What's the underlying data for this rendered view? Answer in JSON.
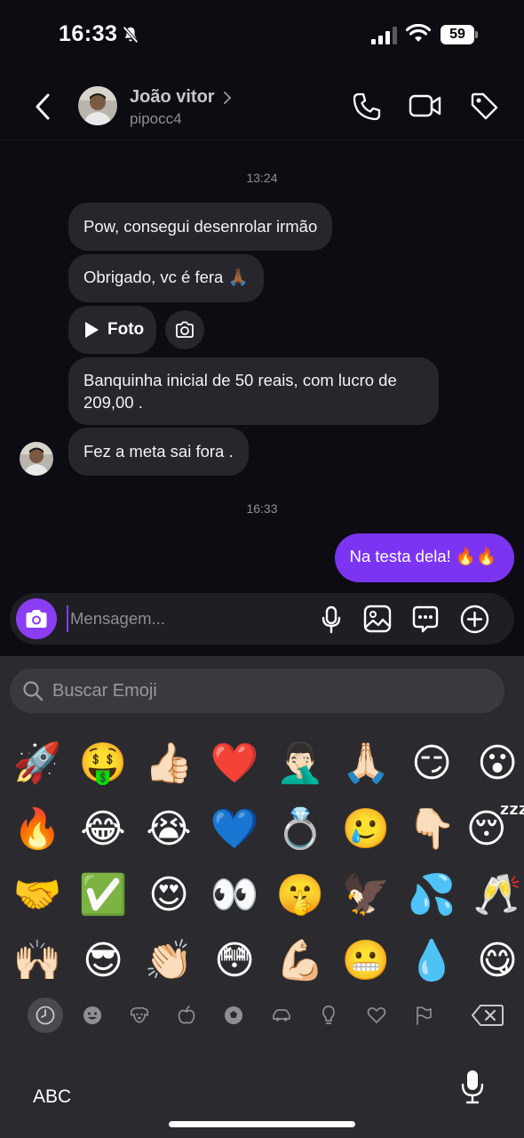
{
  "status_bar": {
    "time": "16:33",
    "battery": "59"
  },
  "header": {
    "contact_name": "João vitor",
    "username": "pipocc4"
  },
  "messages": {
    "timestamp_1": "13:24",
    "m1": "Pow, consegui desenrolar irmão",
    "m2": "Obrigado, vc é fera 🙏🏾",
    "photo_label": "Foto",
    "m3": "Banquinha inicial de 50 reais, com lucro de 209,00 .",
    "m4": "Fez a meta sai fora .",
    "timestamp_2": "16:33",
    "sent_1": "Na testa dela! 🔥🔥"
  },
  "composer": {
    "placeholder": "Mensagem..."
  },
  "keyboard": {
    "search_placeholder": "Buscar Emoji",
    "emojis": [
      "🚀",
      "🤑",
      "👍🏻",
      "❤️",
      "🤦🏻‍♂️",
      "🙏🏻",
      "😏",
      "😮",
      "🔥",
      "😂",
      "😭",
      "💙",
      "💍",
      "🥲",
      "👇🏻",
      "😴",
      "🤝",
      "✅",
      "😍",
      "👀",
      "🤫",
      "🦅",
      "💦",
      "🥂",
      "🙌🏻",
      "😎",
      "👏🏻",
      "😳",
      "💪🏻",
      "😬",
      "💧",
      "😋"
    ],
    "abc_label": "ABC"
  },
  "colors": {
    "accent_purple": "#7b34f2",
    "bubble_gray": "#26262c",
    "background": "#0c0c12"
  }
}
